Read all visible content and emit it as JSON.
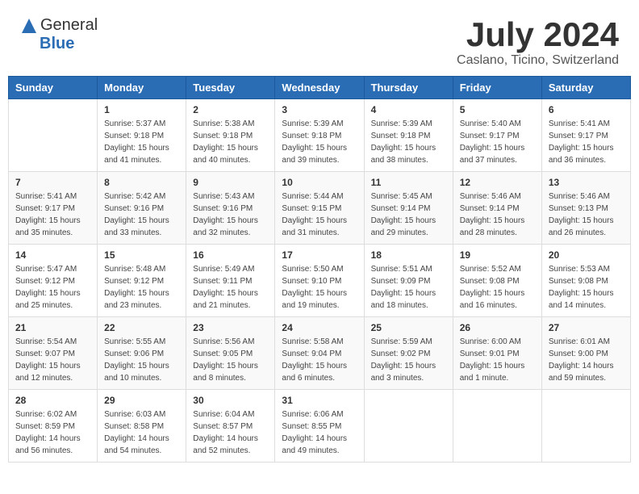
{
  "header": {
    "logo_general": "General",
    "logo_blue": "Blue",
    "title": "July 2024",
    "subtitle": "Caslano, Ticino, Switzerland"
  },
  "calendar": {
    "days_of_week": [
      "Sunday",
      "Monday",
      "Tuesday",
      "Wednesday",
      "Thursday",
      "Friday",
      "Saturday"
    ],
    "weeks": [
      [
        {
          "day": "",
          "sunrise": "",
          "sunset": "",
          "daylight": ""
        },
        {
          "day": "1",
          "sunrise": "Sunrise: 5:37 AM",
          "sunset": "Sunset: 9:18 PM",
          "daylight": "Daylight: 15 hours and 41 minutes."
        },
        {
          "day": "2",
          "sunrise": "Sunrise: 5:38 AM",
          "sunset": "Sunset: 9:18 PM",
          "daylight": "Daylight: 15 hours and 40 minutes."
        },
        {
          "day": "3",
          "sunrise": "Sunrise: 5:39 AM",
          "sunset": "Sunset: 9:18 PM",
          "daylight": "Daylight: 15 hours and 39 minutes."
        },
        {
          "day": "4",
          "sunrise": "Sunrise: 5:39 AM",
          "sunset": "Sunset: 9:18 PM",
          "daylight": "Daylight: 15 hours and 38 minutes."
        },
        {
          "day": "5",
          "sunrise": "Sunrise: 5:40 AM",
          "sunset": "Sunset: 9:17 PM",
          "daylight": "Daylight: 15 hours and 37 minutes."
        },
        {
          "day": "6",
          "sunrise": "Sunrise: 5:41 AM",
          "sunset": "Sunset: 9:17 PM",
          "daylight": "Daylight: 15 hours and 36 minutes."
        }
      ],
      [
        {
          "day": "7",
          "sunrise": "Sunrise: 5:41 AM",
          "sunset": "Sunset: 9:17 PM",
          "daylight": "Daylight: 15 hours and 35 minutes."
        },
        {
          "day": "8",
          "sunrise": "Sunrise: 5:42 AM",
          "sunset": "Sunset: 9:16 PM",
          "daylight": "Daylight: 15 hours and 33 minutes."
        },
        {
          "day": "9",
          "sunrise": "Sunrise: 5:43 AM",
          "sunset": "Sunset: 9:16 PM",
          "daylight": "Daylight: 15 hours and 32 minutes."
        },
        {
          "day": "10",
          "sunrise": "Sunrise: 5:44 AM",
          "sunset": "Sunset: 9:15 PM",
          "daylight": "Daylight: 15 hours and 31 minutes."
        },
        {
          "day": "11",
          "sunrise": "Sunrise: 5:45 AM",
          "sunset": "Sunset: 9:14 PM",
          "daylight": "Daylight: 15 hours and 29 minutes."
        },
        {
          "day": "12",
          "sunrise": "Sunrise: 5:46 AM",
          "sunset": "Sunset: 9:14 PM",
          "daylight": "Daylight: 15 hours and 28 minutes."
        },
        {
          "day": "13",
          "sunrise": "Sunrise: 5:46 AM",
          "sunset": "Sunset: 9:13 PM",
          "daylight": "Daylight: 15 hours and 26 minutes."
        }
      ],
      [
        {
          "day": "14",
          "sunrise": "Sunrise: 5:47 AM",
          "sunset": "Sunset: 9:12 PM",
          "daylight": "Daylight: 15 hours and 25 minutes."
        },
        {
          "day": "15",
          "sunrise": "Sunrise: 5:48 AM",
          "sunset": "Sunset: 9:12 PM",
          "daylight": "Daylight: 15 hours and 23 minutes."
        },
        {
          "day": "16",
          "sunrise": "Sunrise: 5:49 AM",
          "sunset": "Sunset: 9:11 PM",
          "daylight": "Daylight: 15 hours and 21 minutes."
        },
        {
          "day": "17",
          "sunrise": "Sunrise: 5:50 AM",
          "sunset": "Sunset: 9:10 PM",
          "daylight": "Daylight: 15 hours and 19 minutes."
        },
        {
          "day": "18",
          "sunrise": "Sunrise: 5:51 AM",
          "sunset": "Sunset: 9:09 PM",
          "daylight": "Daylight: 15 hours and 18 minutes."
        },
        {
          "day": "19",
          "sunrise": "Sunrise: 5:52 AM",
          "sunset": "Sunset: 9:08 PM",
          "daylight": "Daylight: 15 hours and 16 minutes."
        },
        {
          "day": "20",
          "sunrise": "Sunrise: 5:53 AM",
          "sunset": "Sunset: 9:08 PM",
          "daylight": "Daylight: 15 hours and 14 minutes."
        }
      ],
      [
        {
          "day": "21",
          "sunrise": "Sunrise: 5:54 AM",
          "sunset": "Sunset: 9:07 PM",
          "daylight": "Daylight: 15 hours and 12 minutes."
        },
        {
          "day": "22",
          "sunrise": "Sunrise: 5:55 AM",
          "sunset": "Sunset: 9:06 PM",
          "daylight": "Daylight: 15 hours and 10 minutes."
        },
        {
          "day": "23",
          "sunrise": "Sunrise: 5:56 AM",
          "sunset": "Sunset: 9:05 PM",
          "daylight": "Daylight: 15 hours and 8 minutes."
        },
        {
          "day": "24",
          "sunrise": "Sunrise: 5:58 AM",
          "sunset": "Sunset: 9:04 PM",
          "daylight": "Daylight: 15 hours and 6 minutes."
        },
        {
          "day": "25",
          "sunrise": "Sunrise: 5:59 AM",
          "sunset": "Sunset: 9:02 PM",
          "daylight": "Daylight: 15 hours and 3 minutes."
        },
        {
          "day": "26",
          "sunrise": "Sunrise: 6:00 AM",
          "sunset": "Sunset: 9:01 PM",
          "daylight": "Daylight: 15 hours and 1 minute."
        },
        {
          "day": "27",
          "sunrise": "Sunrise: 6:01 AM",
          "sunset": "Sunset: 9:00 PM",
          "daylight": "Daylight: 14 hours and 59 minutes."
        }
      ],
      [
        {
          "day": "28",
          "sunrise": "Sunrise: 6:02 AM",
          "sunset": "Sunset: 8:59 PM",
          "daylight": "Daylight: 14 hours and 56 minutes."
        },
        {
          "day": "29",
          "sunrise": "Sunrise: 6:03 AM",
          "sunset": "Sunset: 8:58 PM",
          "daylight": "Daylight: 14 hours and 54 minutes."
        },
        {
          "day": "30",
          "sunrise": "Sunrise: 6:04 AM",
          "sunset": "Sunset: 8:57 PM",
          "daylight": "Daylight: 14 hours and 52 minutes."
        },
        {
          "day": "31",
          "sunrise": "Sunrise: 6:06 AM",
          "sunset": "Sunset: 8:55 PM",
          "daylight": "Daylight: 14 hours and 49 minutes."
        },
        {
          "day": "",
          "sunrise": "",
          "sunset": "",
          "daylight": ""
        },
        {
          "day": "",
          "sunrise": "",
          "sunset": "",
          "daylight": ""
        },
        {
          "day": "",
          "sunrise": "",
          "sunset": "",
          "daylight": ""
        }
      ]
    ]
  }
}
